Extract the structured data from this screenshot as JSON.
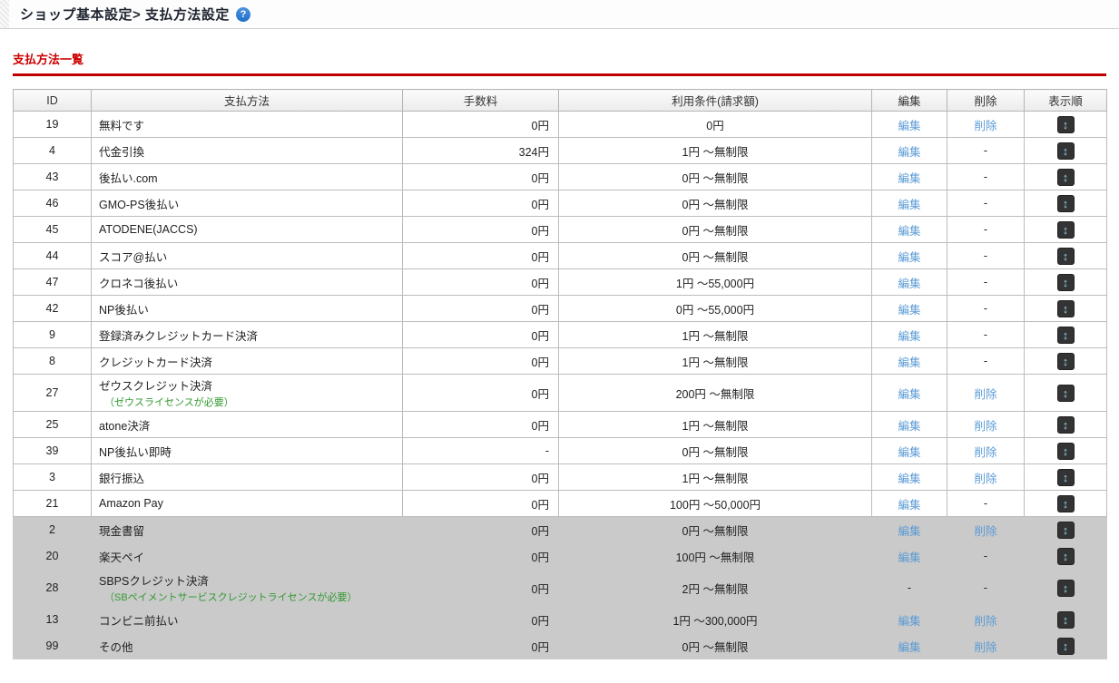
{
  "header": {
    "title": "ショップ基本設定> 支払方法設定",
    "help_glyph": "?"
  },
  "section": {
    "title": "支払方法一覧"
  },
  "table": {
    "columns": [
      "ID",
      "支払方法",
      "手数料",
      "利用条件(請求額)",
      "編集",
      "削除",
      "表示順"
    ],
    "edit_label": "編集",
    "delete_label": "削除",
    "none_label": "-",
    "sort_glyph": "↕",
    "rows": [
      {
        "id": "19",
        "name": "無料です",
        "note": "",
        "fee": "0円",
        "condition": "0円",
        "edit": true,
        "delete": true,
        "disabled": false
      },
      {
        "id": "4",
        "name": "代金引換",
        "note": "",
        "fee": "324円",
        "condition": "1円 ～無制限",
        "edit": true,
        "delete": false,
        "disabled": false
      },
      {
        "id": "43",
        "name": "後払い.com",
        "note": "",
        "fee": "0円",
        "condition": "0円 ～無制限",
        "edit": true,
        "delete": false,
        "disabled": false
      },
      {
        "id": "46",
        "name": "GMO-PS後払い",
        "note": "",
        "fee": "0円",
        "condition": "0円 ～無制限",
        "edit": true,
        "delete": false,
        "disabled": false
      },
      {
        "id": "45",
        "name": "ATODENE(JACCS)",
        "note": "",
        "fee": "0円",
        "condition": "0円 ～無制限",
        "edit": true,
        "delete": false,
        "disabled": false
      },
      {
        "id": "44",
        "name": "スコア@払い",
        "note": "",
        "fee": "0円",
        "condition": "0円 ～無制限",
        "edit": true,
        "delete": false,
        "disabled": false
      },
      {
        "id": "47",
        "name": "クロネコ後払い",
        "note": "",
        "fee": "0円",
        "condition": "1円 ～55,000円",
        "edit": true,
        "delete": false,
        "disabled": false
      },
      {
        "id": "42",
        "name": "NP後払い",
        "note": "",
        "fee": "0円",
        "condition": "0円 ～55,000円",
        "edit": true,
        "delete": false,
        "disabled": false
      },
      {
        "id": "9",
        "name": "登録済みクレジットカード決済",
        "note": "",
        "fee": "0円",
        "condition": "1円 ～無制限",
        "edit": true,
        "delete": false,
        "disabled": false
      },
      {
        "id": "8",
        "name": "クレジットカード決済",
        "note": "",
        "fee": "0円",
        "condition": "1円 ～無制限",
        "edit": true,
        "delete": false,
        "disabled": false
      },
      {
        "id": "27",
        "name": "ゼウスクレジット決済",
        "note": "（ゼウスライセンスが必要）",
        "fee": "0円",
        "condition": "200円 ～無制限",
        "edit": true,
        "delete": true,
        "disabled": false
      },
      {
        "id": "25",
        "name": "atone決済",
        "note": "",
        "fee": "0円",
        "condition": "1円 ～無制限",
        "edit": true,
        "delete": true,
        "disabled": false
      },
      {
        "id": "39",
        "name": "NP後払い即時",
        "note": "",
        "fee": "-",
        "condition": "0円 ～無制限",
        "edit": true,
        "delete": true,
        "disabled": false
      },
      {
        "id": "3",
        "name": "銀行振込",
        "note": "",
        "fee": "0円",
        "condition": "1円 ～無制限",
        "edit": true,
        "delete": true,
        "disabled": false
      },
      {
        "id": "21",
        "name": "Amazon Pay",
        "note": "",
        "fee": "0円",
        "condition": "100円 ～50,000円",
        "edit": true,
        "delete": false,
        "disabled": false
      },
      {
        "id": "2",
        "name": "現金書留",
        "note": "",
        "fee": "0円",
        "condition": "0円 ～無制限",
        "edit": true,
        "delete": true,
        "disabled": true
      },
      {
        "id": "20",
        "name": "楽天ペイ",
        "note": "",
        "fee": "0円",
        "condition": "100円 ～無制限",
        "edit": true,
        "delete": false,
        "disabled": true
      },
      {
        "id": "28",
        "name": "SBPSクレジット決済",
        "note": "（SBペイメントサービスクレジットライセンスが必要）",
        "fee": "0円",
        "condition": "2円 ～無制限",
        "edit": false,
        "delete": false,
        "disabled": true
      },
      {
        "id": "13",
        "name": "コンビニ前払い",
        "note": "",
        "fee": "0円",
        "condition": "1円 ～300,000円",
        "edit": true,
        "delete": true,
        "disabled": true
      },
      {
        "id": "99",
        "name": "その他",
        "note": "",
        "fee": "0円",
        "condition": "0円 ～無制限",
        "edit": true,
        "delete": true,
        "disabled": true
      }
    ]
  }
}
